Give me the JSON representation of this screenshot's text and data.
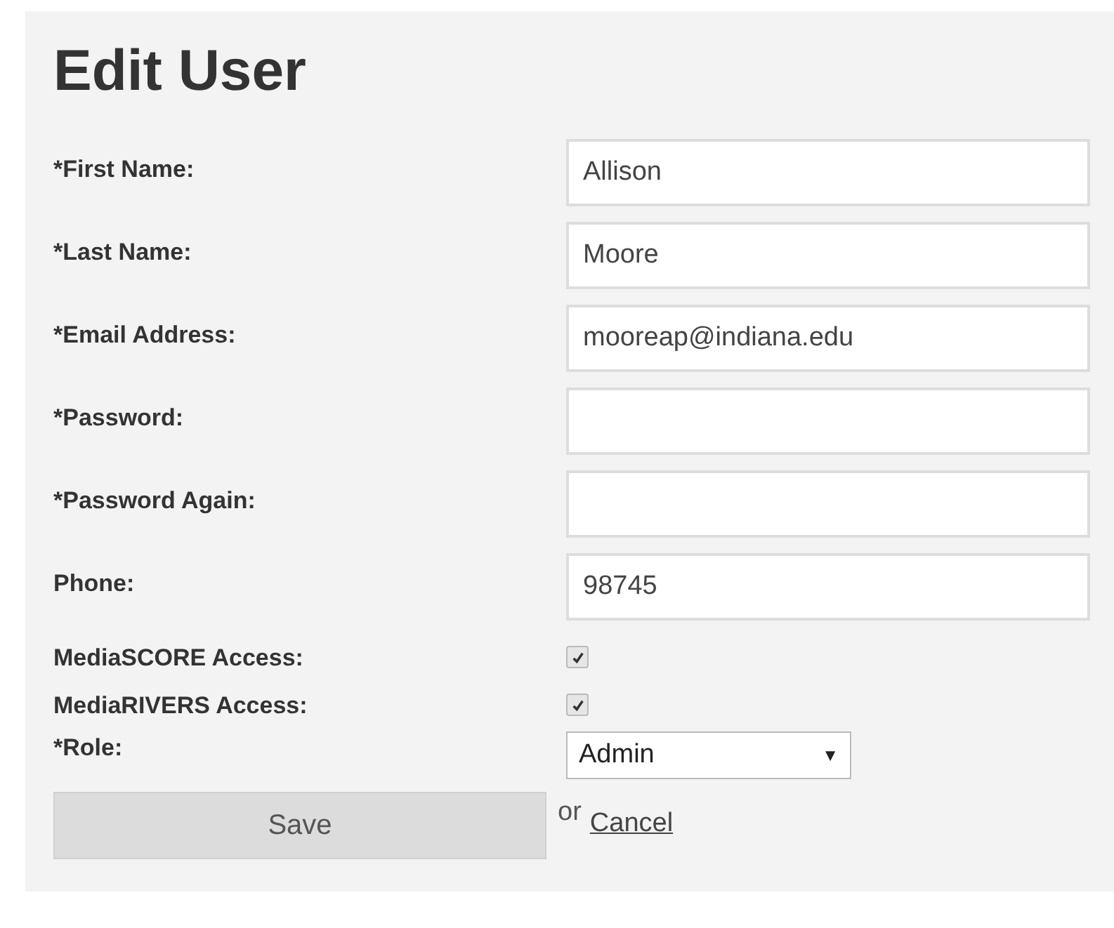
{
  "title": "Edit User",
  "fields": [
    {
      "kind": "text",
      "label": "*First Name:",
      "value": "Allison"
    },
    {
      "kind": "text",
      "label": "*Last Name:",
      "value": "Moore"
    },
    {
      "kind": "text",
      "label": "*Email Address:",
      "value": "mooreap@indiana.edu"
    },
    {
      "kind": "password",
      "label": "*Password:"
    },
    {
      "kind": "password",
      "label": "*Password Again:"
    },
    {
      "kind": "text",
      "label": "Phone:",
      "value": "98745"
    },
    {
      "kind": "checkbox",
      "label": "MediaSCORE Access:",
      "checked": true
    },
    {
      "kind": "checkbox",
      "label": "MediaRIVERS Access:",
      "checked": true
    },
    {
      "kind": "select",
      "label": "*Role:",
      "value": "Admin",
      "arrow": "▼"
    }
  ],
  "save_button": "Save",
  "or_text": "or",
  "cancel_link": "Cancel"
}
